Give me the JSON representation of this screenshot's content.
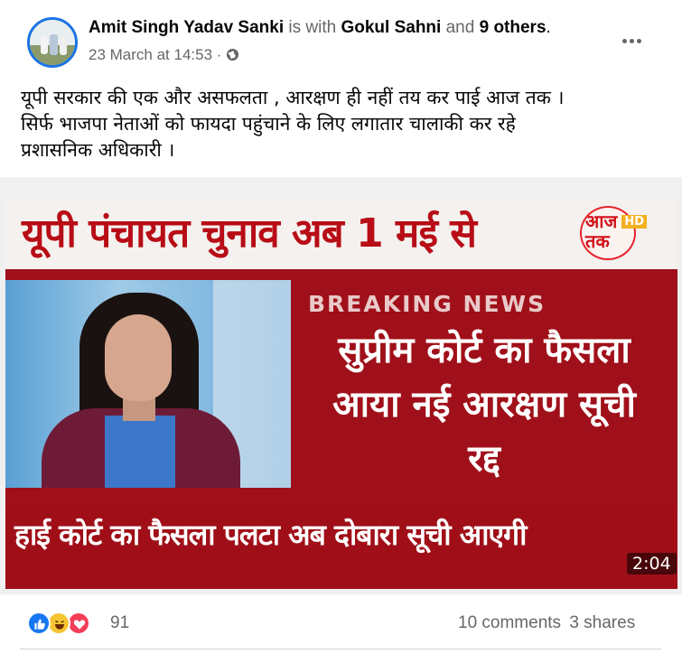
{
  "post": {
    "author": "Amit Singh Yadav Sanki",
    "with_text": "is with",
    "tagged": "Gokul Sahni",
    "and_text": "and",
    "others": "9 others",
    "period": ".",
    "timestamp": "23 March at 14:53",
    "separator": "·",
    "privacy_icon": "globe-icon",
    "caption_lines": [
      "यूपी सरकार की एक और असफलता  , आरक्षण ही नहीं तय कर पाई आज तक ।",
      "सिर्फ भाजपा नेताओं को फायदा पहुंचाने के लिए लगातार चालाकी कर रहे",
      "प्रशासनिक अधिकारी ।"
    ]
  },
  "media": {
    "title": "यूपी पंचायत चुनाव अब 1 मई से",
    "logo_text": "आज तक",
    "logo_badge": "HD",
    "breaking": "BREAKING NEWS",
    "headline_lines": [
      "सुप्रीम कोर्ट का फैसला",
      "आया नई आरक्षण सूची",
      "रद्द"
    ],
    "ticker": "हाई कोर्ट का फैसला पलटा अब दोबारा सूची आएगी",
    "duration": "2:04"
  },
  "footer": {
    "reaction_icons": [
      "like-icon",
      "haha-icon",
      "love-icon"
    ],
    "reaction_count": "91",
    "comments": "10 comments",
    "shares": "3 shares"
  },
  "colors": {
    "accent": "#1b74e4",
    "muted_text": "#65676b",
    "channel_red": "#b80d16"
  }
}
